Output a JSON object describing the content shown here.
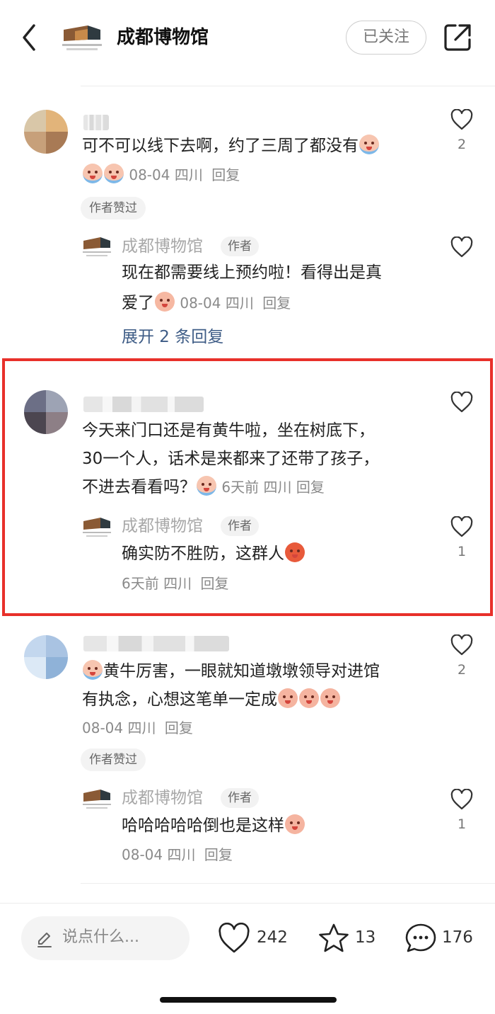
{
  "header": {
    "title": "成都博物馆",
    "follow_label": "已关注"
  },
  "comments": [
    {
      "text": "可不可以线下去啊，约了三周了都没有",
      "date": "08-04",
      "location": "四川",
      "reply_label": "回复",
      "like_count": "2",
      "liked_by_author_label": "作者赞过",
      "author_reply": {
        "name": "成都博物馆",
        "tag": "作者",
        "text_line1": "现在都需要线上预约啦！看得出是真",
        "text_line2": "爱了",
        "date": "08-04",
        "location": "四川",
        "reply_label": "回复"
      },
      "expand_label": "展开 2 条回复"
    },
    {
      "text_line1": "今天来门口还是有黄牛啦，坐在树底下，",
      "text_line2": "30一个人，话术是来都来了还带了孩子，",
      "text_line3": "不进去看看吗？",
      "date": "6天前",
      "location": "四川",
      "reply_label": "回复",
      "author_reply": {
        "name": "成都博物馆",
        "tag": "作者",
        "text": "确实防不胜防，这群人",
        "date": "6天前",
        "location": "四川",
        "reply_label": "回复",
        "like_count": "1"
      }
    },
    {
      "text_line1": "黄牛厉害，一眼就知道墩墩领导对进馆",
      "text_line2": "有执念，心想这笔单一定成",
      "date": "08-04",
      "location": "四川",
      "reply_label": "回复",
      "like_count": "2",
      "liked_by_author_label": "作者赞过",
      "author_reply": {
        "name": "成都博物馆",
        "tag": "作者",
        "text": "哈哈哈哈哈倒也是这样",
        "date": "08-04",
        "location": "四川",
        "reply_label": "回复",
        "like_count": "1"
      }
    }
  ],
  "bottom_bar": {
    "input_placeholder": "说点什么...",
    "likes": "242",
    "favorites": "13",
    "comments": "176"
  },
  "colors": {
    "highlight": "#e8302a",
    "link": "#3e5c86"
  }
}
